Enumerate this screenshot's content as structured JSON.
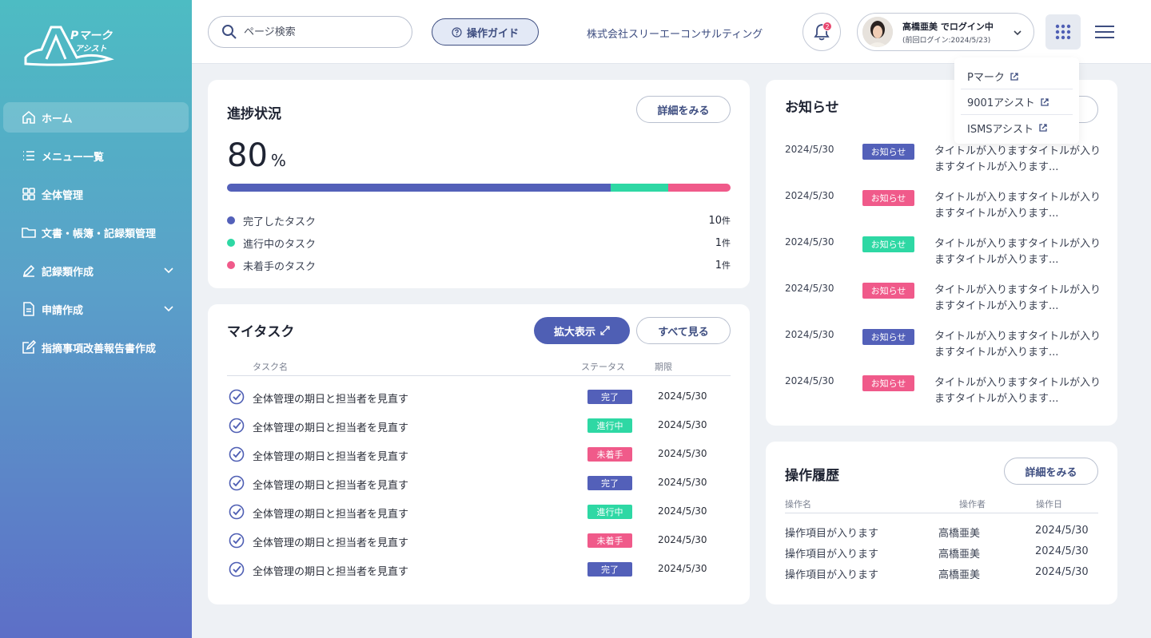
{
  "colors": {
    "done": "#5360b9",
    "in_progress": "#2ed8a4",
    "not_started": "#f05a8a",
    "accent": "#3d4d80"
  },
  "logo": {
    "line1": "Pマーク",
    "line2": "アシスト"
  },
  "sidebar": {
    "items": [
      {
        "label": "ホーム",
        "icon": "home-icon"
      },
      {
        "label": "メニュー一覧",
        "icon": "list-icon"
      },
      {
        "label": "全体管理",
        "icon": "grid-icon"
      },
      {
        "label": "文書・帳簿・記録類管理",
        "icon": "folder-icon"
      },
      {
        "label": "記録類作成",
        "icon": "pen-icon"
      },
      {
        "label": "申請作成",
        "icon": "document-icon"
      },
      {
        "label": "指摘事項改善報告書作成",
        "icon": "edit-icon"
      }
    ]
  },
  "header": {
    "search_placeholder": "ページ検索",
    "guide_label": "操作ガイド",
    "company": "株式会社スリーエーコンサルティング",
    "notification_count": "2",
    "user_name": "高橋亜美 でログイン中",
    "last_login": "(前回ログイン:2024/5/23)"
  },
  "dropdown": {
    "items": [
      "Pマーク",
      "9001アシスト",
      "ISMSアシスト"
    ]
  },
  "progress": {
    "title": "進捗状況",
    "detail_label": "詳細をみる",
    "percent": "80",
    "percent_unit": "%",
    "done_fraction": 0.762,
    "in_progress_fraction": 0.114,
    "not_started_fraction": 0.124,
    "legend": [
      {
        "label": "完了したタスク",
        "count": "10",
        "unit": "件"
      },
      {
        "label": "進行中のタスク",
        "count": "1",
        "unit": "件"
      },
      {
        "label": "未着手のタスク",
        "count": "1",
        "unit": "件"
      }
    ]
  },
  "mytask": {
    "title": "マイタスク",
    "expand_label": "拡大表示",
    "all_label": "すべて見る",
    "headers": {
      "name": "タスク名",
      "status": "ステータス",
      "due": "期限"
    },
    "rows": [
      {
        "name": "全体管理の期日と担当者を見直す",
        "status": "完了",
        "due": "2024/5/30"
      },
      {
        "name": "全体管理の期日と担当者を見直す",
        "status": "進行中",
        "due": "2024/5/30"
      },
      {
        "name": "全体管理の期日と担当者を見直す",
        "status": "未着手",
        "due": "2024/5/30"
      },
      {
        "name": "全体管理の期日と担当者を見直す",
        "status": "完了",
        "due": "2024/5/30"
      },
      {
        "name": "全体管理の期日と担当者を見直す",
        "status": "進行中",
        "due": "2024/5/30"
      },
      {
        "name": "全体管理の期日と担当者を見直す",
        "status": "未着手",
        "due": "2024/5/30"
      },
      {
        "name": "全体管理の期日と担当者を見直す",
        "status": "完了",
        "due": "2024/5/30"
      }
    ]
  },
  "news": {
    "title": "お知らせ",
    "rows": [
      {
        "date": "2024/5/30",
        "badge": "お知らせ",
        "badge_color": "#5360b9",
        "text": "タイトルが入りますタイトルが入りますタイトルが入ります..."
      },
      {
        "date": "2024/5/30",
        "badge": "お知らせ",
        "badge_color": "#f05a8a",
        "text": "タイトルが入りますタイトルが入りますタイトルが入ります..."
      },
      {
        "date": "2024/5/30",
        "badge": "お知らせ",
        "badge_color": "#2ed8a4",
        "text": "タイトルが入りますタイトルが入りますタイトルが入ります..."
      },
      {
        "date": "2024/5/30",
        "badge": "お知らせ",
        "badge_color": "#f05a8a",
        "text": "タイトルが入りますタイトルが入りますタイトルが入ります..."
      },
      {
        "date": "2024/5/30",
        "badge": "お知らせ",
        "badge_color": "#5360b9",
        "text": "タイトルが入りますタイトルが入りますタイトルが入ります..."
      },
      {
        "date": "2024/5/30",
        "badge": "お知らせ",
        "badge_color": "#f05a8a",
        "text": "タイトルが入りますタイトルが入りますタイトルが入ります..."
      }
    ]
  },
  "history": {
    "title": "操作履歴",
    "detail_label": "詳細をみる",
    "headers": {
      "name": "操作名",
      "operator": "操作者",
      "date": "操作日"
    },
    "rows": [
      {
        "name": "操作項目が入ります",
        "operator": "高橋亜美",
        "date": "2024/5/30"
      },
      {
        "name": "操作項目が入ります",
        "operator": "高橋亜美",
        "date": "2024/5/30"
      },
      {
        "name": "操作項目が入ります",
        "operator": "高橋亜美",
        "date": "2024/5/30"
      }
    ]
  }
}
